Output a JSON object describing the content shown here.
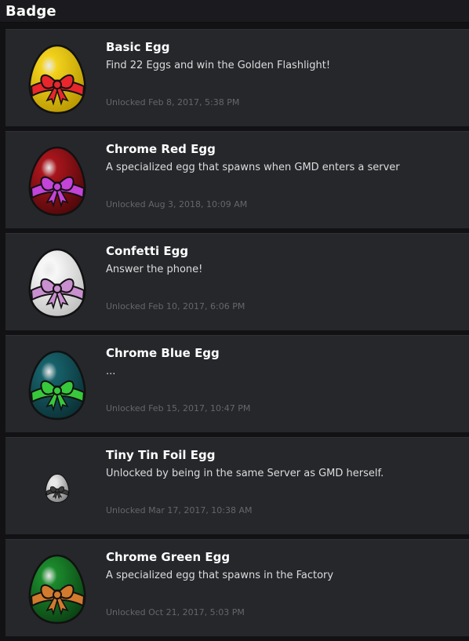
{
  "header": {
    "title": "Badge"
  },
  "badges": [
    {
      "title": "Basic Egg",
      "description": "Find 22 Eggs and win the Golden Flashlight!",
      "unlocked": "Unlocked Feb 8, 2017, 5:38 PM",
      "icon": "yellow-egg-icon",
      "egg_color": "#f2d21c",
      "egg_shade": "#b59500",
      "ribbon_color": "#e8262c"
    },
    {
      "title": "Chrome Red Egg",
      "description": "A specialized egg that spawns when GMD enters a server",
      "unlocked": "Unlocked Aug 3, 2018, 10:09 AM",
      "icon": "red-egg-icon",
      "egg_color": "#a8151c",
      "egg_shade": "#4a0709",
      "ribbon_color": "#c443d8"
    },
    {
      "title": "Confetti Egg",
      "description": "Answer the phone!",
      "unlocked": "Unlocked Feb 10, 2017, 6:06 PM",
      "icon": "white-egg-icon",
      "egg_color": "#f7f7f7",
      "egg_shade": "#bdbdbd",
      "ribbon_color": "#c98fcf"
    },
    {
      "title": "Chrome Blue Egg",
      "description": "...",
      "unlocked": "Unlocked Feb 15, 2017, 10:47 PM",
      "icon": "blue-egg-icon",
      "egg_color": "#17616a",
      "egg_shade": "#0a2e33",
      "ribbon_color": "#38c83b"
    },
    {
      "title": "Tiny Tin Foil Egg",
      "description": "Unlocked by being in the same Server as GMD herself.",
      "unlocked": "Unlocked Mar 17, 2017, 10:38 AM",
      "icon": "tin-foil-egg-icon",
      "egg_color": "#e6e6e6",
      "egg_shade": "#7a7a7a",
      "ribbon_color": "#3a3a3a"
    },
    {
      "title": "Chrome Green Egg",
      "description": "A specialized egg that spawns in the Factory",
      "unlocked": "Unlocked Oct 21, 2017, 5:03 PM",
      "icon": "green-egg-icon",
      "egg_color": "#1b8a2c",
      "egg_shade": "#0a3d12",
      "ribbon_color": "#d27a2d"
    }
  ]
}
